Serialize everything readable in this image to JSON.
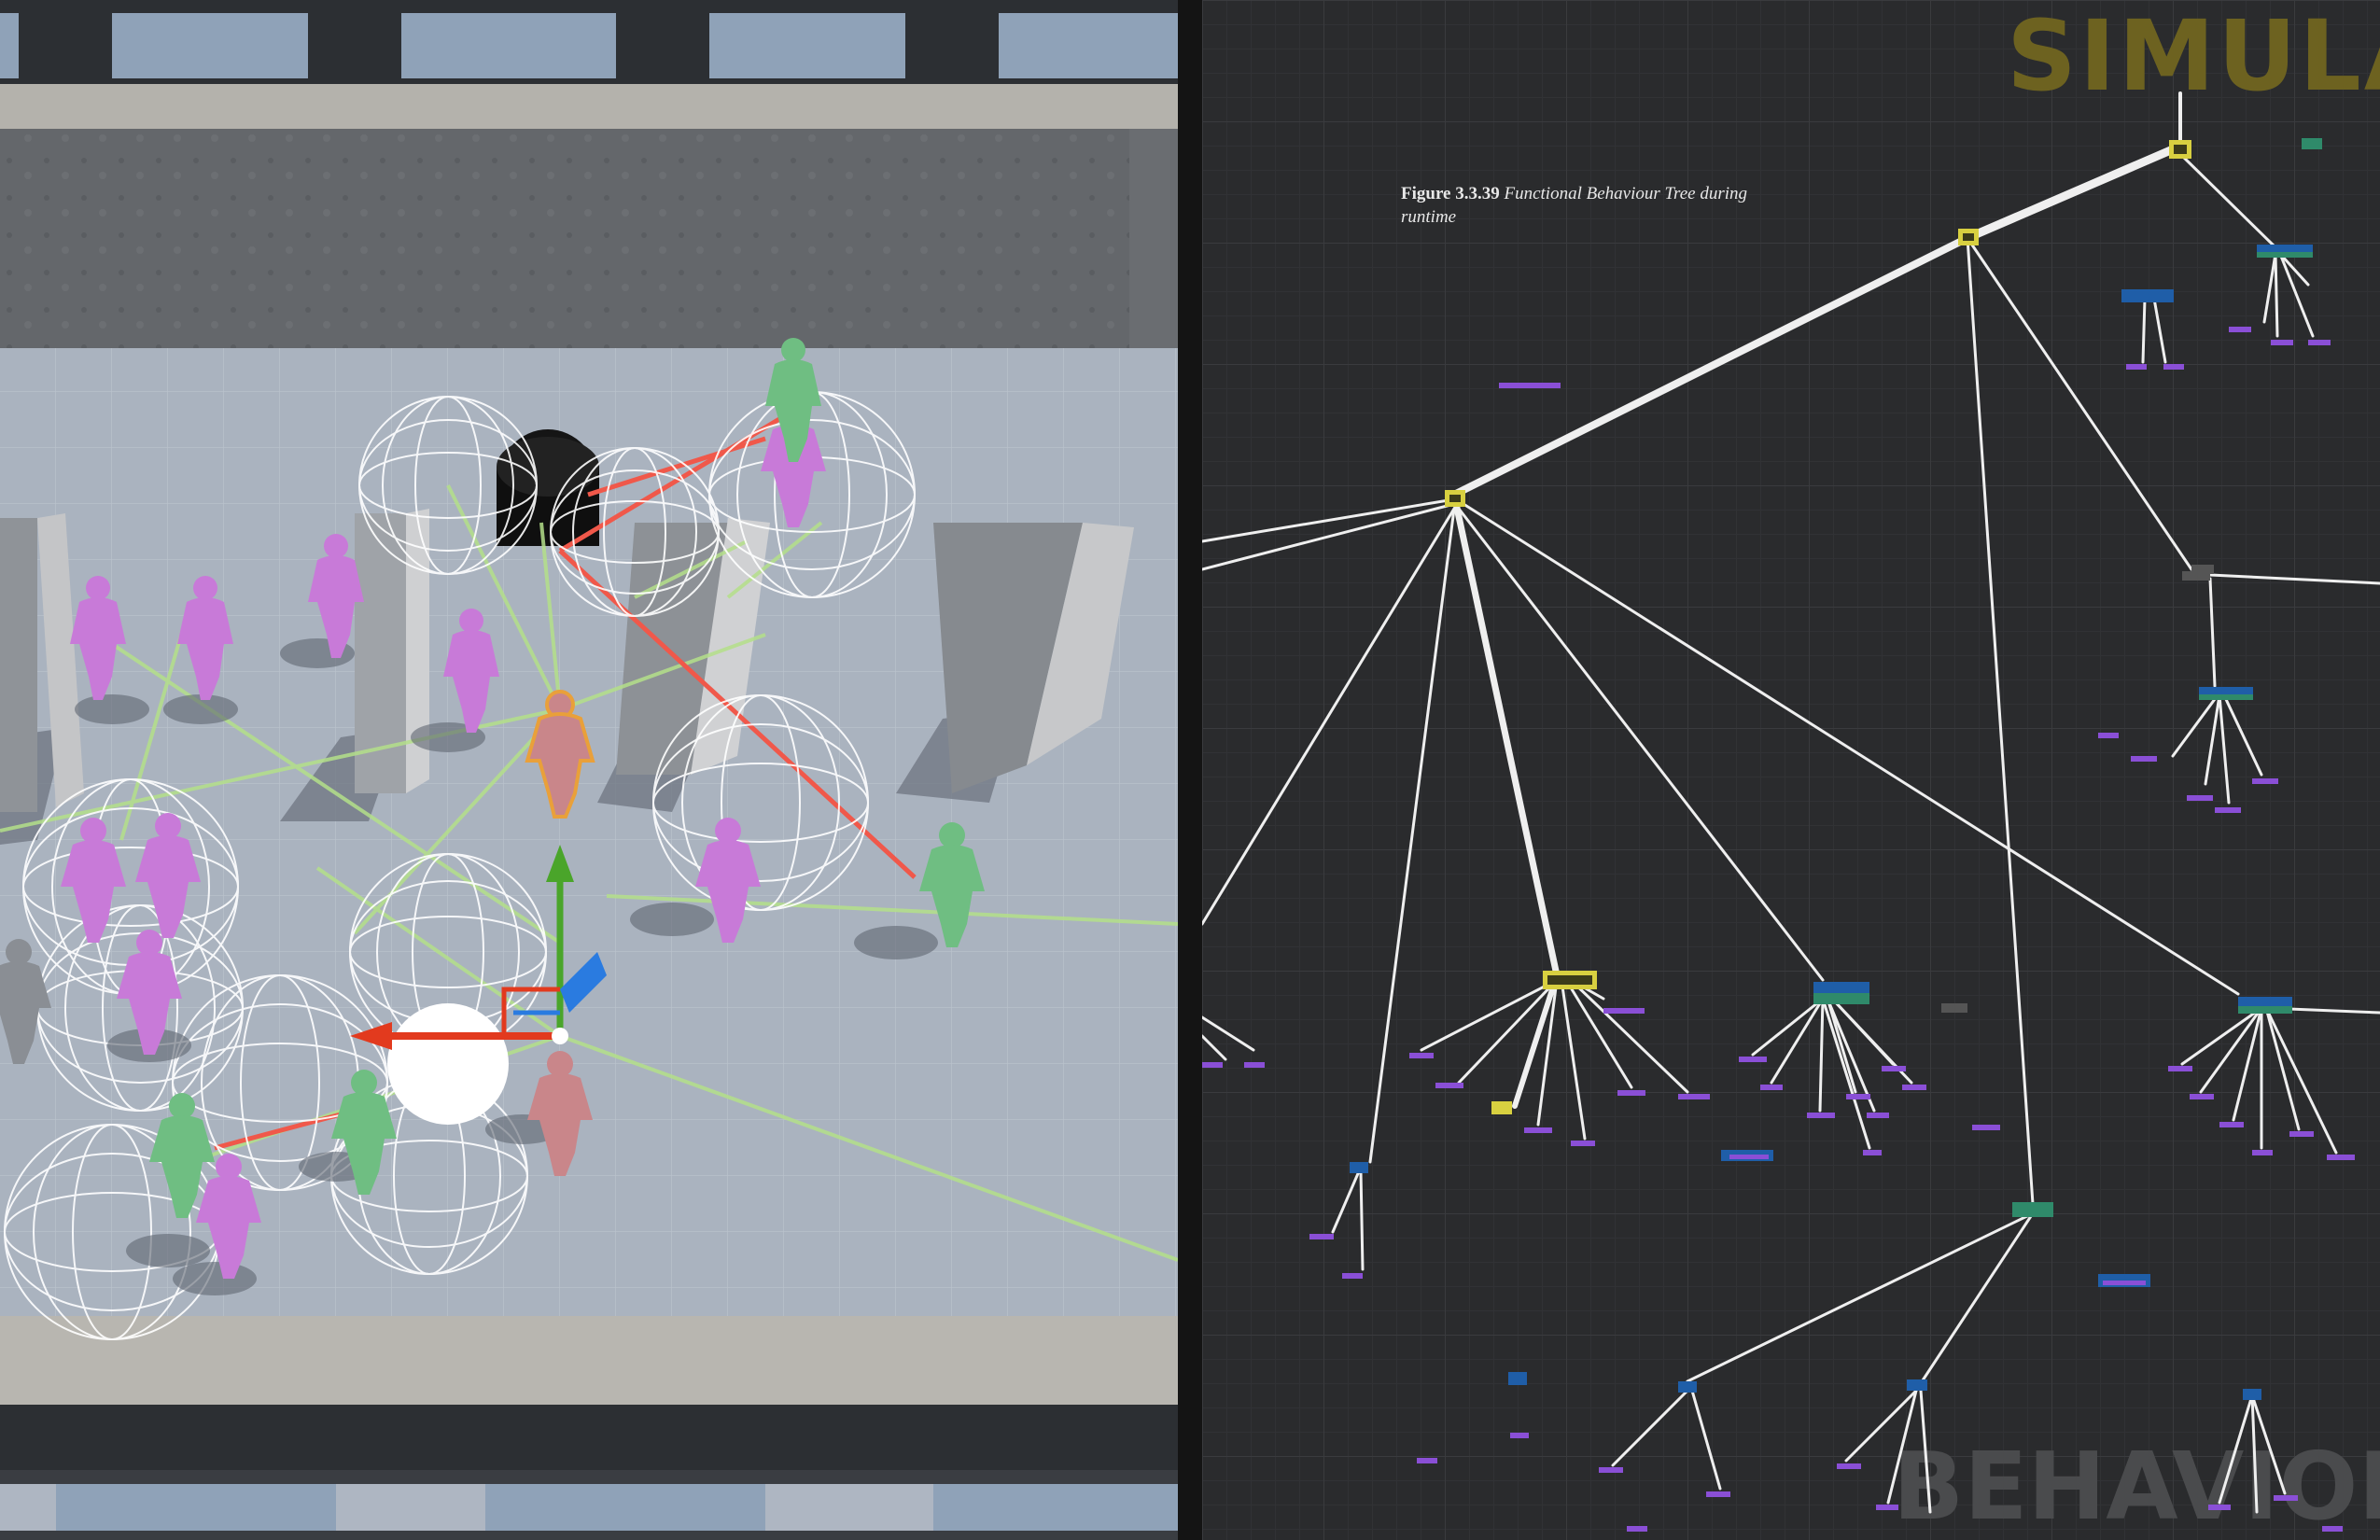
{
  "viewport": {
    "colors": {
      "floor": "#aeb6c2",
      "wall": "#5f6266",
      "agent_purple": "#c87ad8",
      "agent_green": "#6fbe82",
      "selected_agent": "#e9a03a"
    }
  },
  "graph_panel": {
    "title_top": "SIMULATI",
    "title_bottom": "BEHAVIOR T",
    "caption_label": "Figure 3.3.39",
    "caption_text": "Functional Behaviour Tree during runtime",
    "colors": {
      "background": "#2a2b2d",
      "wire": "#eeeeee",
      "leaf": "#8a4fd6",
      "active": "#d8d040",
      "composite": "#2a6fbf"
    }
  }
}
